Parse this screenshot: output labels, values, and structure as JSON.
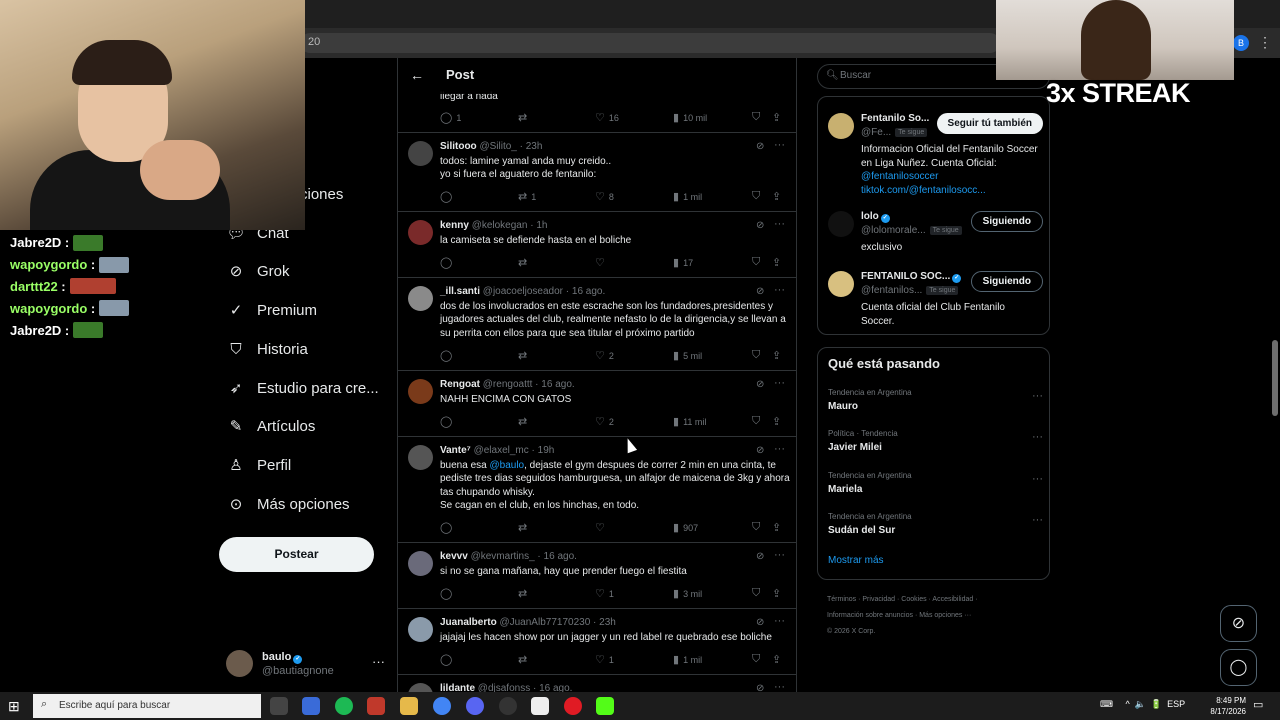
{
  "browser": {
    "url_fragment": "20"
  },
  "overlay": {
    "streak_text": "3x STREAK",
    "chat": [
      {
        "user": "Jabre2D",
        "color": "#ffffff",
        "emote_color": "#3a7a2a"
      },
      {
        "user": "wapoygordo",
        "color": "#9aff66",
        "emote_color": "#8899aa"
      },
      {
        "user": "darttt22",
        "color": "#9aff66",
        "emote_color": "#b04030"
      },
      {
        "user": "wapoygordo",
        "color": "#9aff66",
        "emote_color": "#8899aa"
      },
      {
        "user": "Jabre2D",
        "color": "#ffffff",
        "emote_color": "#3a7a2a"
      }
    ]
  },
  "nav": {
    "items": [
      {
        "label": "Chat",
        "icon": "chat-icon"
      },
      {
        "label": "Grok",
        "icon": "grok-icon"
      },
      {
        "label": "Premium",
        "icon": "premium-icon"
      },
      {
        "label": "Historia",
        "icon": "bookmark-icon"
      },
      {
        "label": "Estudio para cre...",
        "icon": "rocket-icon"
      },
      {
        "label": "Artículos",
        "icon": "article-icon"
      },
      {
        "label": "Perfil",
        "icon": "profile-icon"
      },
      {
        "label": "Más opciones",
        "icon": "more-options-icon"
      }
    ],
    "partial_label": "ciones",
    "post_button": "Postear",
    "account": {
      "name": "baulo",
      "handle": "@bautiagnone"
    }
  },
  "post": {
    "header_title": "Post",
    "top_partial_text": "llegar a nada",
    "top_actions": {
      "replies": "1",
      "reposts": "",
      "likes": "16",
      "views": "10 mil"
    },
    "replies": [
      {
        "name": "Silitooo",
        "handle": "@Silito_",
        "time": "23h",
        "avatar_color": "#444",
        "text": "todos: lamine yamal anda muy creido..\nyo si fuera el aguatero de fentanilo:",
        "replies": "",
        "reposts": "1",
        "likes": "8",
        "views": "1 mil"
      },
      {
        "name": "kenny",
        "handle": "@kelokegan",
        "time": "1h",
        "avatar_color": "#7a2a2a",
        "text": "la camiseta se defiende hasta en el boliche",
        "replies": "",
        "reposts": "",
        "likes": "",
        "views": "17"
      },
      {
        "name": "_ill.santi",
        "handle": "@joacoeljoseador",
        "time": "16 ago.",
        "avatar_color": "#8a8a8a",
        "text": "dos de los involucrados en este escrache son los fundadores,presidentes y jugadores actuales del club, realmente nefasto lo de la dirigencia,y se llevan a su perrita con ellos para que sea titular el próximo partido",
        "replies": "",
        "reposts": "",
        "likes": "2",
        "views": "5 mil"
      },
      {
        "name": "Rengoat",
        "handle": "@rengoattt",
        "time": "16 ago.",
        "avatar_color": "#7a3a1a",
        "text": "NAHH ENCIMA CON GATOS",
        "replies": "",
        "reposts": "",
        "likes": "2",
        "views": "11 mil"
      },
      {
        "name": "Vante⁷",
        "handle": "@elaxel_mc",
        "time": "19h",
        "avatar_color": "#555",
        "text_before": "buena esa ",
        "mention": "@baulo",
        "text_after": ", dejaste el gym despues de correr 2 min en una cinta, te pediste tres dias seguidos hamburguesa, un alfajor de maicena de 3kg y ahora tas chupando whisky.\nSe cagan en el club, en los hinchas, en todo.",
        "replies": "",
        "reposts": "",
        "likes": "",
        "views": "907"
      },
      {
        "name": "kevvv",
        "handle": "@kevmartins_",
        "time": "16 ago.",
        "avatar_color": "#6a6a7a",
        "text": "si no se gana mañana, hay que prender fuego el fiestita",
        "replies": "",
        "reposts": "",
        "likes": "1",
        "views": "3 mil"
      },
      {
        "name": "Juanalberto",
        "handle": "@JuanAlb77170230",
        "time": "23h",
        "avatar_color": "#8a9aaa",
        "text": "jajajaj les hacen show por un jagger y un red label re quebrado ese boliche",
        "replies": "",
        "reposts": "",
        "likes": "1",
        "views": "1 mil"
      },
      {
        "name": "lildante",
        "handle": "@djsafonss",
        "time": "16 ago.",
        "avatar_color": "#555",
        "text": "",
        "replies": "",
        "reposts": "",
        "likes": "",
        "views": ""
      }
    ]
  },
  "right": {
    "search_placeholder": "Buscar",
    "relevant_people": [
      {
        "name": "Fentanilo So...",
        "handle": "@Fe...",
        "badge": "Te sigue",
        "button": "Seguir tú también",
        "button_style": "follow",
        "verified": false,
        "avatar_color": "#c8b070",
        "bio": "Informacion Oficial del Fentanilo Soccer en Liga Nuñez. Cuenta Oficial:",
        "bio_link1": "@fentanilosoccer",
        "bio_link2": "tiktok.com/@fentanilosocc..."
      },
      {
        "name": "lolo",
        "handle": "@lolomorale...",
        "badge": "Te sigue",
        "button": "Siguiendo",
        "button_style": "following",
        "verified": true,
        "avatar_color": "#111111",
        "bio": "exclusivo"
      },
      {
        "name": "FENTANILO SOC...",
        "handle": "@fentanilos...",
        "badge": "Te sigue",
        "button": "Siguiendo",
        "button_style": "following",
        "verified": true,
        "avatar_color": "#d8c080",
        "bio": "Cuenta oficial del Club Fentanilo Soccer."
      }
    ],
    "trends_title": "Qué está pasando",
    "trends": [
      {
        "context": "Tendencia en Argentina",
        "name": "Mauro"
      },
      {
        "context": "Política · Tendencia",
        "name": "Javier Milei"
      },
      {
        "context": "Tendencia en Argentina",
        "name": "Mariela"
      },
      {
        "context": "Tendencia en Argentina",
        "name": "Sudán del Sur"
      }
    ],
    "show_more": "Mostrar más",
    "footer_line1": "Términos  ·  Privacidad  ·  Cookies  ·  Accesibilidad  ·",
    "footer_line2": "Información sobre anuncios  ·  Más opciones ···",
    "footer_line3": "© 2026 X Corp."
  },
  "taskbar": {
    "search_placeholder": "Escribe aquí para buscar",
    "lang": "ESP",
    "time": "8:49 PM",
    "date": "8/17/2026"
  }
}
